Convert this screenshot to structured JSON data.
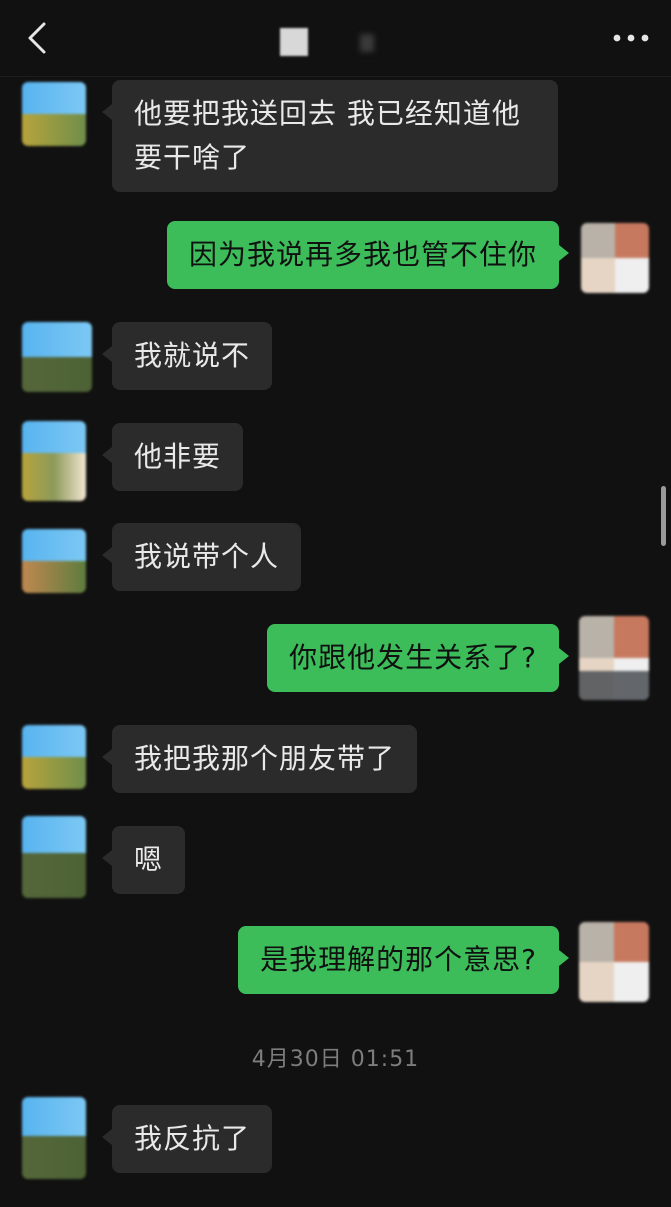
{
  "header": {
    "title": "",
    "back_icon": "chevron-left-icon",
    "more_icon": "more-horizontal-icon"
  },
  "colors": {
    "background": "#111111",
    "incoming_bubble": "#2b2b2b",
    "outgoing_bubble": "#3cbd5a",
    "timestamp_text": "#7d7d7d"
  },
  "messages": [
    {
      "side": "in",
      "text": "他要把我送回去 我已经知道他要干啥了"
    },
    {
      "side": "out",
      "text": "因为我说再多我也管不住你"
    },
    {
      "side": "in",
      "text": "我就说不"
    },
    {
      "side": "in",
      "text": "他非要"
    },
    {
      "side": "in",
      "text": "我说带个人"
    },
    {
      "side": "out",
      "text": "你跟他发生关系了?"
    },
    {
      "side": "in",
      "text": "我把我那个朋友带了"
    },
    {
      "side": "in",
      "text": "嗯"
    },
    {
      "side": "out",
      "text": "是我理解的那个意思?"
    },
    {
      "side": "in",
      "text": "我反抗了"
    }
  ],
  "timestamp": "4月30日 01:51"
}
